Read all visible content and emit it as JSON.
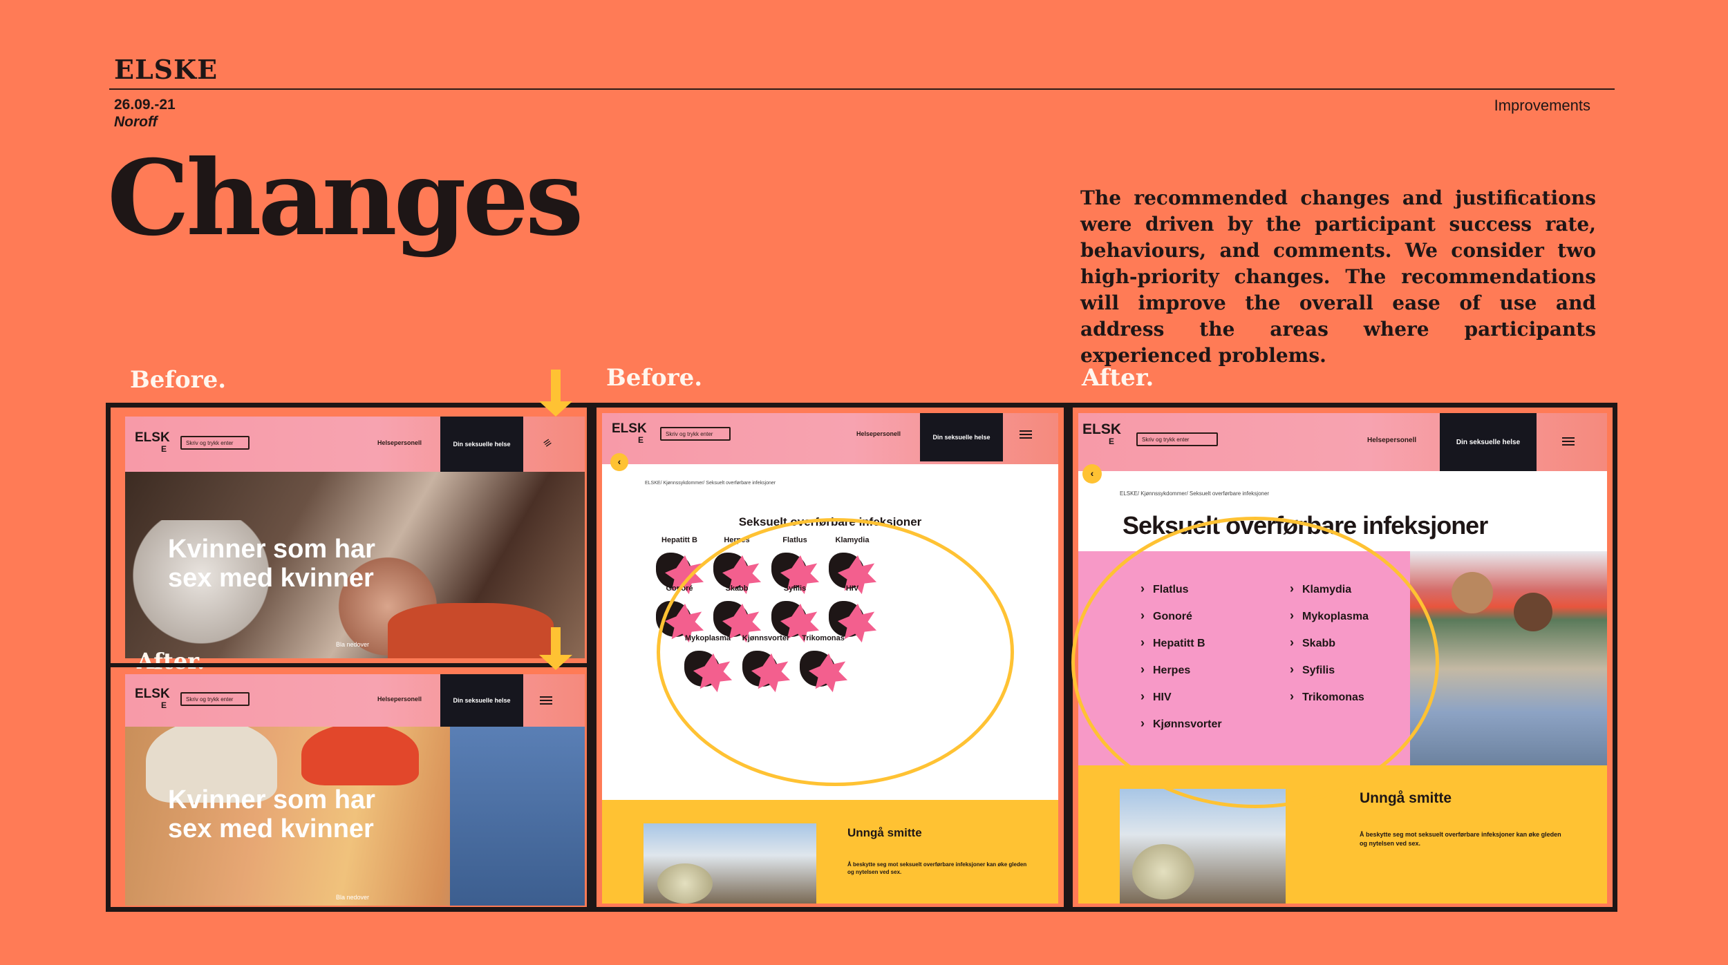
{
  "header": {
    "brand": "ELSKE",
    "date": "26.09.-21",
    "org": "Noroff",
    "section": "Improvements"
  },
  "title": "Changes",
  "intro": "The recommended changes and justifications were driven by the participant success rate, behaviours, and comments. We consider two high-priority changes. The recommendations will improve the overall ease of use and address the areas where participants experienced problems.",
  "captions": {
    "before1": "Before.",
    "after1": "After.",
    "before2": "Before.",
    "after2": "After."
  },
  "mock": {
    "logo": "ELSK",
    "logo_sub": "E",
    "search_placeholder": "Skriv og trykk enter",
    "nav_link": "Helsepersonell",
    "nav_dark": "Din seksuelle helse",
    "hero_title_line1": "Kvinner som har",
    "hero_title_line2": "sex med kvinner",
    "scroll_hint": "Bla nedover",
    "breadcrumb": "ELSKE/ Kjønnssykdommer/ Seksuelt overførbare infeksjoner",
    "sti_heading": "Seksuelt overførbare infeksjoner",
    "sti_grid": [
      "Hepatitt B",
      "Herpes",
      "Flatlus",
      "Klamydia",
      "Gonoré",
      "Skabb",
      "Syfilis",
      "HIV",
      "Mykoplasma",
      "Kjønnsvorter",
      "Trikomonas"
    ],
    "list_left": [
      "Flatlus",
      "Gonoré",
      "Hepatitt B",
      "Herpes",
      "HIV",
      "Kjønnsvorter"
    ],
    "list_right": [
      "Klamydia",
      "Mykoplasma",
      "Skabb",
      "Syfilis",
      "Trikomonas"
    ],
    "avoid_title": "Unngå smitte",
    "avoid_text": "Å beskytte seg mot seksuelt overførbare infeksjoner kan øke gleden og nytelsen ved sex."
  },
  "colors": {
    "background": "#FF7B56",
    "highlight": "#FFC233",
    "pink": "#F79AA8",
    "dark": "#16161E"
  }
}
